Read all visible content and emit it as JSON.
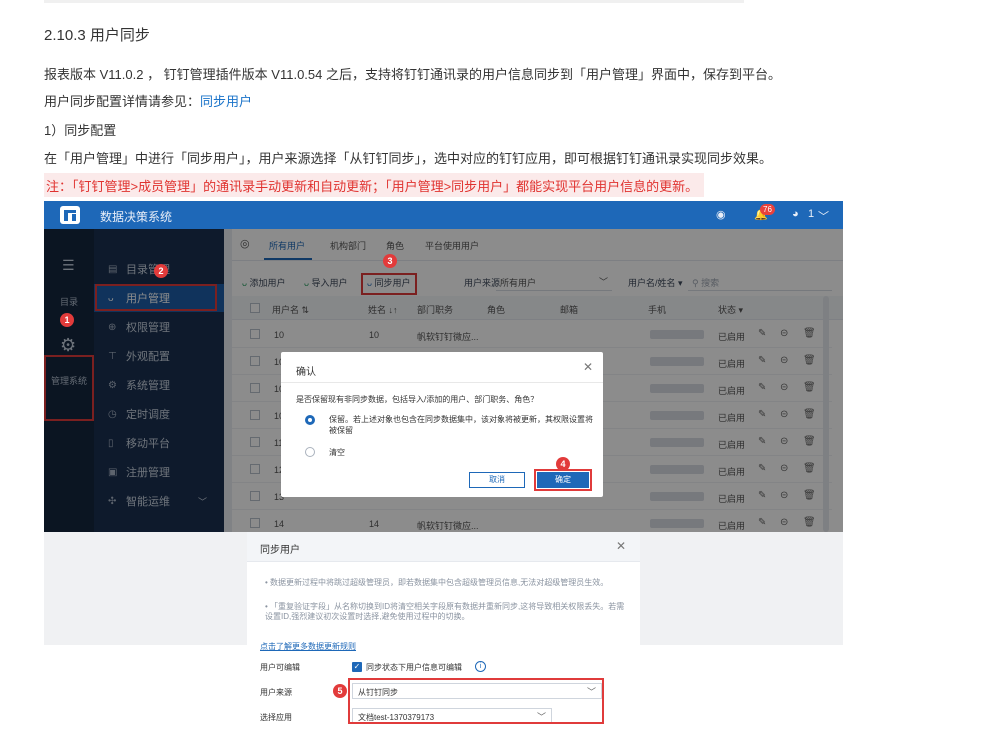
{
  "doc": {
    "heading": "2.10.3 用户同步",
    "p1": "报表版本 V11.0.2 ， 钉钉管理插件版本 V11.0.54 之后，支持将钉钉通讯录的用户信息同步到「用户管理」界面中，保存到平台。",
    "p2_text": "用户同步配置详情请参见：",
    "p2_link": "同步用户",
    "p3": "1）同步配置",
    "p4": "在「用户管理」中进行「同步用户」，用户来源选择「从钉钉同步」，选中对应的钉钉应用，即可根据钉钉通讯录实现同步效果。",
    "note": "注：「钉钉管理>成员管理」的通讯录手动更新和自动更新；「用户管理>同步用户」都能实现平台用户信息的更新。"
  },
  "app": {
    "title": "数据决策系统",
    "badge": "76",
    "user": "1",
    "rail": {
      "dir_label": "目录",
      "mgmt_label": "管理系统"
    },
    "menu": [
      {
        "label": "目录管理",
        "icon": "directory-icon"
      },
      {
        "label": "用户管理",
        "icon": "user-icon"
      },
      {
        "label": "权限管理",
        "icon": "lock-icon"
      },
      {
        "label": "外观配置",
        "icon": "appearance-icon"
      },
      {
        "label": "系统管理",
        "icon": "gear-icon"
      },
      {
        "label": "定时调度",
        "icon": "clock-icon"
      },
      {
        "label": "移动平台",
        "icon": "mobile-icon"
      },
      {
        "label": "注册管理",
        "icon": "register-icon"
      },
      {
        "label": "智能运维",
        "icon": "ops-icon"
      }
    ],
    "tabs": [
      "所有用户",
      "机构部门",
      "角色",
      "平台使用用户"
    ],
    "toolbar": {
      "add": "添加用户",
      "import": "导入用户",
      "sync": "同步用户",
      "source_label": "用户来源",
      "source_value": "所有用户",
      "search_type": "用户名/姓名",
      "search_placeholder": "搜索"
    },
    "table": {
      "headers": [
        "用户名",
        "姓名",
        "部门职务",
        "角色",
        "邮箱",
        "手机",
        "状态"
      ],
      "rows": [
        {
          "username": "10",
          "name": "10",
          "dept": "帆软钉钉微应...",
          "status": "已启用"
        },
        {
          "username": "10",
          "name": "",
          "dept": "",
          "status": "已启用"
        },
        {
          "username": "10",
          "name": "",
          "dept": "",
          "status": "已启用"
        },
        {
          "username": "10",
          "name": "",
          "dept": "",
          "status": "已启用"
        },
        {
          "username": "11",
          "name": "",
          "dept": "",
          "status": "已启用"
        },
        {
          "username": "12",
          "name": "",
          "dept": "",
          "status": "已启用"
        },
        {
          "username": "13",
          "name": "",
          "dept": "",
          "status": "已启用"
        },
        {
          "username": "14",
          "name": "14",
          "dept": "帆软钉钉微应...",
          "status": "已启用"
        }
      ]
    },
    "confirm": {
      "title": "确认",
      "question": "是否保留现有非同步数据，包括导入/添加的用户、部门职务、角色？",
      "opt1": "保留。若上述对象也包含在同步数据集中，该对象将被更新，其权限设置将被保留",
      "opt2": "清空",
      "cancel": "取消",
      "ok": "确定"
    },
    "sync_dialog": {
      "title": "同步用户",
      "bullet1": "数据更新过程中将跳过超级管理员，即若数据集中包含超级管理员信息,无法对超级管理员生效。",
      "bullet2": "「重复验证字段」从名称切换到ID将清空相关字段原有数据并重新同步,这将导致相关权限丢失。若需设置ID,强烈建议初次设置时选择,避免使用过程中的切换。",
      "link": "点击了解更多数据更新规则",
      "editable_label": "用户可编辑",
      "editable_text": "同步状态下用户信息可编辑",
      "source_label": "用户来源",
      "source_value": "从钉钉同步",
      "app_label": "选择应用",
      "app_value": "文档test-1370379173"
    },
    "markers": [
      "1",
      "2",
      "3",
      "4",
      "5"
    ]
  }
}
